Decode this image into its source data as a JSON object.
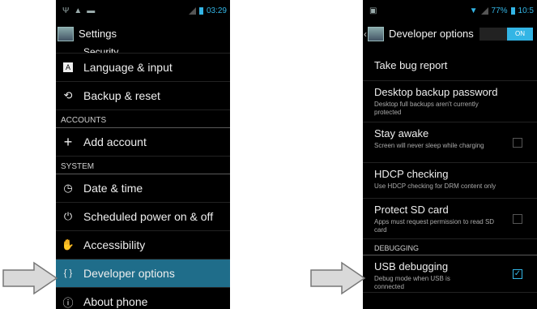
{
  "left": {
    "status": {
      "time": "03:29"
    },
    "title": "Settings",
    "top_partial": "Security",
    "items": [
      {
        "icon": "A",
        "label": "Language & input"
      },
      {
        "icon": "⟲",
        "label": "Backup & reset"
      }
    ],
    "accounts_header": "ACCOUNTS",
    "add_account": {
      "icon": "+",
      "label": "Add account"
    },
    "system_header": "SYSTEM",
    "system_items": [
      {
        "icon": "◷",
        "label": "Date & time"
      },
      {
        "icon": "⏻",
        "label": "Scheduled power on & off"
      },
      {
        "icon": "✋",
        "label": "Accessibility"
      },
      {
        "icon": "{ }",
        "label": "Developer options"
      },
      {
        "icon": "ⓘ",
        "label": "About phone"
      }
    ]
  },
  "right": {
    "status": {
      "battery": "77%",
      "time": "10:5"
    },
    "title": "Developer options",
    "toggle": "ON",
    "items": [
      {
        "title": "Take bug report",
        "sub": ""
      },
      {
        "title": "Desktop backup password",
        "sub": "Desktop full backups aren't currently protected"
      },
      {
        "title": "Stay awake",
        "sub": "Screen will never sleep while charging"
      },
      {
        "title": "HDCP checking",
        "sub": "Use HDCP checking for DRM content only"
      },
      {
        "title": "Protect SD card",
        "sub": "Apps must request permission to read SD card"
      }
    ],
    "debugging_header": "DEBUGGING",
    "usb": {
      "title": "USB debugging",
      "sub": "Debug mode when USB is connected"
    }
  }
}
